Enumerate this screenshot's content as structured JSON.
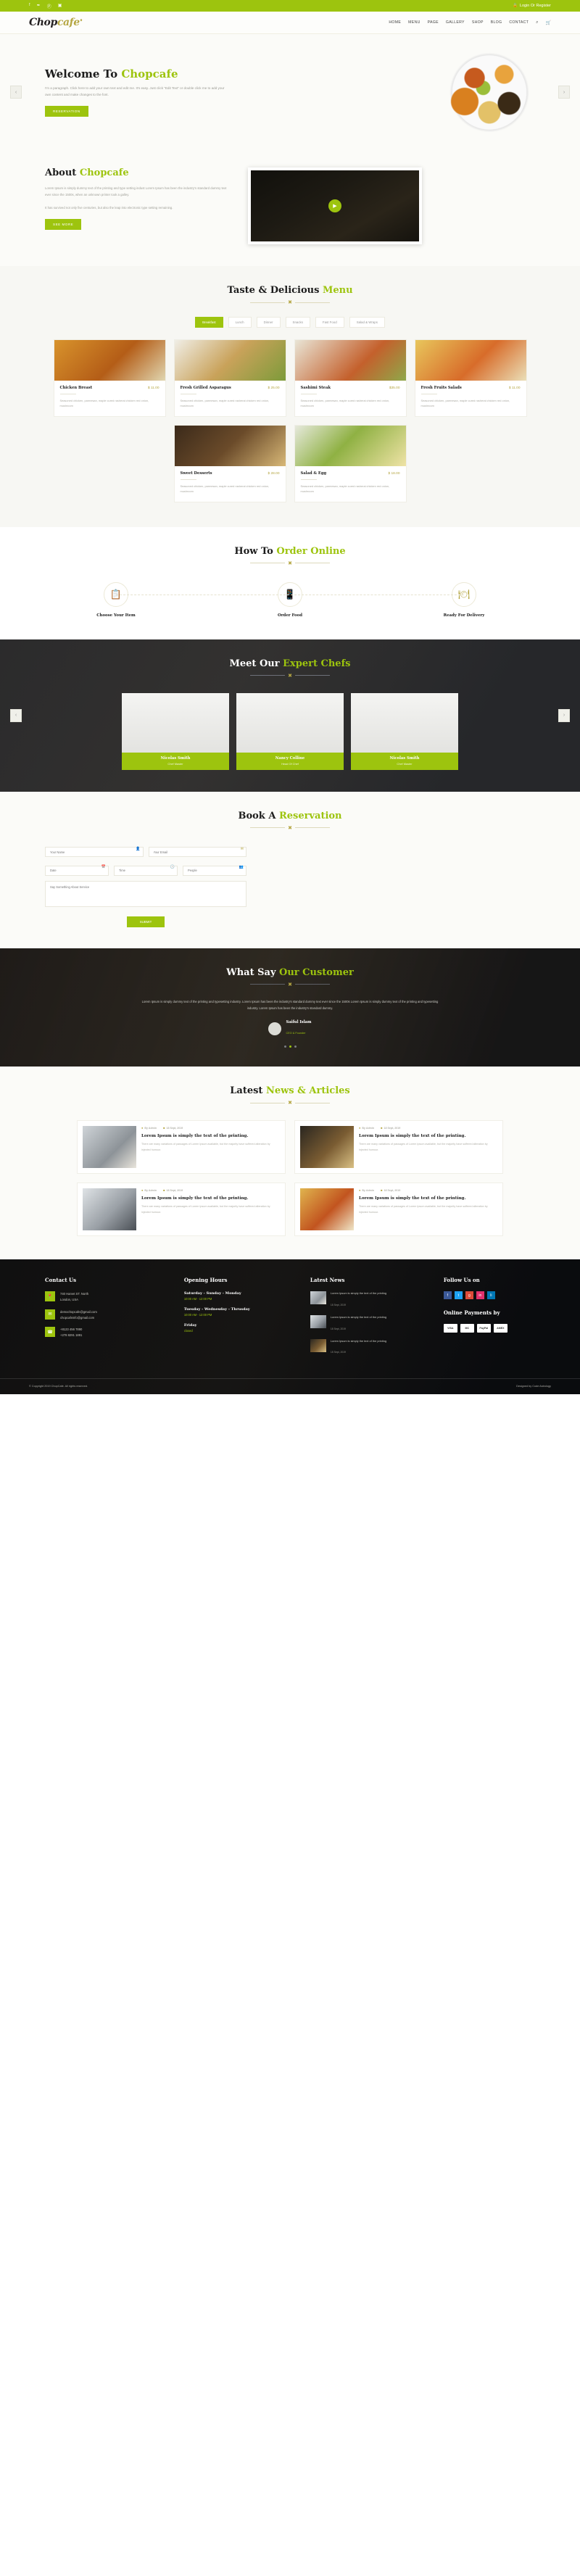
{
  "topbar": {
    "social": [
      {
        "name": "facebook-icon",
        "glyph": "f"
      },
      {
        "name": "twitter-icon",
        "glyph": "✒"
      },
      {
        "name": "pinterest-icon",
        "glyph": "Ⓟ"
      },
      {
        "name": "instagram-icon",
        "glyph": "▣"
      }
    ],
    "login_label": "Login Or Register",
    "lock_glyph": "🔒"
  },
  "header": {
    "logo_main": "Chop",
    "logo_accent": "cafe",
    "logo_sup": "♦",
    "nav": [
      "HOME",
      "MENU",
      "PAGE",
      "GALLERY",
      "SHOP",
      "BLOG",
      "CONTACT"
    ],
    "search_glyph": "⌕",
    "cart_glyph": "🛒"
  },
  "hero": {
    "title_dark": "Welcome To ",
    "title_accent": "Chopcafe",
    "paragraph": "I'm a paragraph. Click here to add your own text and edit me. It's easy. Just click “Edit Text” or double click me to add your own content and make changes to the font.",
    "button": "RESERVATION",
    "prev": "‹",
    "next": "›"
  },
  "about": {
    "title_dark": "About ",
    "title_accent": "Chopcafe",
    "paragraph1": "Lorem Ipsum is simply dummy text of the printing and type setting indust Lorem Ipsum has been the industry's standard dummy text ever since the 1500s, when an unknown printer took a galley.",
    "paragraph2": "It has survived not only five centuries, but also the leap into electronic type setting remaining.",
    "button": "SEE MORE",
    "play_glyph": "▶"
  },
  "menu": {
    "title_dark": "Taste & Delicious ",
    "title_accent": "Menu",
    "tabs": [
      "Breakfast",
      "Lunch",
      "Dinner",
      "Snacks",
      "Fast Food",
      "Salad & Wraps"
    ],
    "active_tab": "Breakfast",
    "items": [
      {
        "name": "Chicken Breast",
        "price": "$ 11.00",
        "desc": "Seasoned chicken, parmesan, maple cured rasherai chicken red onion, mushroom"
      },
      {
        "name": "Fresh Grilled Asparagus",
        "price": "$ 25.00",
        "desc": "Seasoned chicken, parmesan, maple cured rasherai chicken red onion, mushroom"
      },
      {
        "name": "Sashimi Steak",
        "price": "$35.00",
        "desc": "Seasoned chicken, parmesan, maple cured rasherai chicken red onion, mushroom"
      },
      {
        "name": "Fresh Fruits Salads",
        "price": "$ 11.00",
        "desc": "Seasoned chicken, parmesan, maple cured rasherai chicken red onion, mushroom"
      },
      {
        "name": "Sweet Desserts",
        "price": "$ 28.00",
        "desc": "Seasoned chicken, parmesan, maple cured rasherai chicken red onion, mushroom"
      },
      {
        "name": "Salad & Egg",
        "price": "$ 18.00",
        "desc": "Seasoned chicken, parmesan, maple cured rasherai chicken red onion, mushroom"
      }
    ]
  },
  "order": {
    "title_dark": "How To ",
    "title_accent": "Order Online",
    "steps": [
      {
        "label": "Choose Your Item",
        "glyph": "📋"
      },
      {
        "label": "Order Food",
        "glyph": "📱"
      },
      {
        "label": "Ready For Delivery",
        "glyph": "🍽"
      }
    ]
  },
  "chefs": {
    "title_dark": "Meet Our ",
    "title_accent": "Expert Chefs",
    "list": [
      {
        "name": "Nicolas Smith",
        "role": "Chef Master"
      },
      {
        "name": "Nancy Colline",
        "role": "Head Of Chef"
      },
      {
        "name": "Nicolas Smith",
        "role": "Chef Master"
      }
    ],
    "prev": "‹",
    "next": "›"
  },
  "reservation": {
    "title_dark": "Book A ",
    "title_accent": "Reservation",
    "fields": [
      {
        "name": "name-field",
        "placeholder": "Your Name",
        "icon": "👤"
      },
      {
        "name": "email-field",
        "placeholder": "Your Email",
        "icon": "✉"
      },
      {
        "name": "date-field",
        "placeholder": "Date",
        "icon": "📅"
      },
      {
        "name": "time-field",
        "placeholder": "Time",
        "icon": "🕒"
      },
      {
        "name": "people-field",
        "placeholder": "People",
        "icon": "👥"
      }
    ],
    "message_placeholder": "Say Something About Service",
    "submit": "SUBMIT"
  },
  "testimonial": {
    "title_dark": "What Say ",
    "title_accent": "Our Customer",
    "quote": "Lorem Ipsum is simply dummy text of the printing and typesetting industry. Lorem Ipsum has been the industry's standard dummy text ever since the 1500s Lorem Ipsum is simply dummy text of the printing and typesetting industry. Lorem Ipsum has been the industry's standard dummy.",
    "author": "Saiful Islam",
    "author_role": "CEO & Founder"
  },
  "news": {
    "title_dark": "Latest ",
    "title_accent": "News & Articles",
    "posts": [
      {
        "author": "By Admin",
        "date": "18 Sept, 2019",
        "title": "Lorem Ipsum is simply the text of the printing.",
        "excerpt": "There are many variations of passages of Lorem Ipsum available, but the majority have suffered alteration by injected humour."
      },
      {
        "author": "By Admin",
        "date": "18 Sept, 2019",
        "title": "Lorem Ipsum is simply the text of the printing.",
        "excerpt": "There are many variations of passages of Lorem Ipsum available, but the majority have suffered alteration by injected humour."
      },
      {
        "author": "By Admin",
        "date": "18 Sept, 2019",
        "title": "Lorem Ipsum is simply the text of the printing.",
        "excerpt": "There are many variations of passages of Lorem Ipsum available, but the majority have suffered alteration by injected humour."
      },
      {
        "author": "By Admin",
        "date": "18 Sept, 2019",
        "title": "Lorem Ipsum is simply the text of the printing.",
        "excerpt": "There are many variations of passages of Lorem Ipsum available, but the majority have suffered alteration by injected humour."
      }
    ]
  },
  "footer": {
    "contact_title": "Contact Us",
    "contact": [
      {
        "icon": "📍",
        "lines": [
          "740 Harvet ST. North",
          "London, USA"
        ]
      },
      {
        "icon": "✉",
        "lines": [
          "demochopcafe@gmail.com",
          "chopcafeinfo@gmail.com"
        ]
      },
      {
        "icon": "☎",
        "lines": [
          "+8123 456 7890",
          "+278 8291 1891"
        ]
      }
    ],
    "hours_title": "Opening Hours",
    "hours": [
      {
        "days": "Saturday - Sunday - Monday",
        "time": "10:00 AM - 12:00 PM"
      },
      {
        "days": "Tuesday - Wednesday - Thrusday",
        "time": "10:00 AM - 12:00 PM"
      },
      {
        "days": "Friday",
        "time": "closed"
      }
    ],
    "news_title": "Latest News",
    "news": [
      {
        "title": "Lorem Ipsum is simply the text of the printing",
        "date": "18 Sept, 2019"
      },
      {
        "title": "Lorem Ipsum is simply the text of the printing",
        "date": "18 Sept, 2019"
      },
      {
        "title": "Lorem Ipsum is simply the text of the printing",
        "date": "18 Sept, 2019"
      }
    ],
    "follow_title": "Follow Us on",
    "social": [
      {
        "name": "facebook-icon",
        "glyph": "f",
        "cls": "s-fb"
      },
      {
        "name": "twitter-icon",
        "glyph": "t",
        "cls": "s-tw"
      },
      {
        "name": "google-plus-icon",
        "glyph": "g",
        "cls": "s-gp"
      },
      {
        "name": "instagram-icon",
        "glyph": "in",
        "cls": "s-in"
      },
      {
        "name": "linkedin-icon",
        "glyph": "li",
        "cls": "s-li"
      }
    ],
    "payments_title": "Online Payments by",
    "payments": [
      "VISA",
      "MC",
      "PayPal",
      "AMEX"
    ],
    "copyright": "© Copyright 2019 ChopCafe. All rights reserved.",
    "credit": "Designed by Code Astrology"
  },
  "colors": {
    "accent": "#9dc40e",
    "gold": "#b5a642",
    "dark": "#1c1c1c"
  }
}
